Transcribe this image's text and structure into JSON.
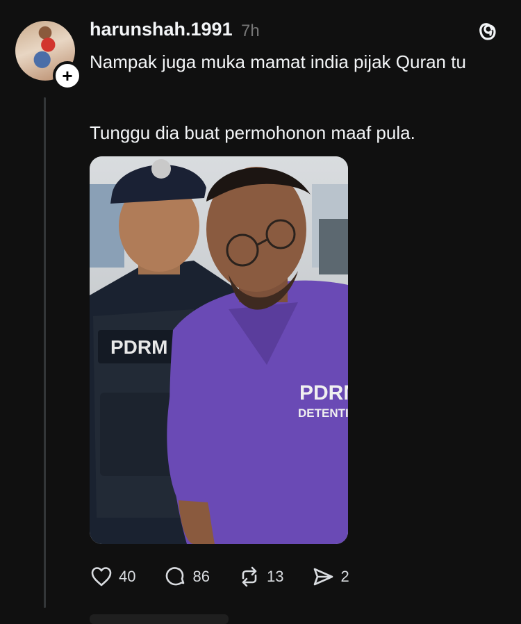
{
  "post": {
    "username": "harunshah.1991",
    "time": "7h",
    "paragraph1": "Nampak juga muka mamat india pijak Quran tu",
    "paragraph2": "Tunggu dia buat permohonon maaf pula.",
    "image_text": {
      "vest_label": "PDRM",
      "shirt_label_1": "PDRM",
      "shirt_label_2": "DETENTION"
    }
  },
  "actions": {
    "likes": "40",
    "comments": "86",
    "reposts": "13",
    "shares": "2"
  },
  "icons": {
    "threads_logo": "threads-logo-icon",
    "like": "heart-icon",
    "comment": "comment-bubble-icon",
    "repost": "repost-icon",
    "share": "send-icon",
    "follow": "plus-icon"
  },
  "colors": {
    "background": "#101010",
    "text": "#f3f5f7",
    "muted": "#777777",
    "scrub_purple": "#6a4ab5"
  }
}
